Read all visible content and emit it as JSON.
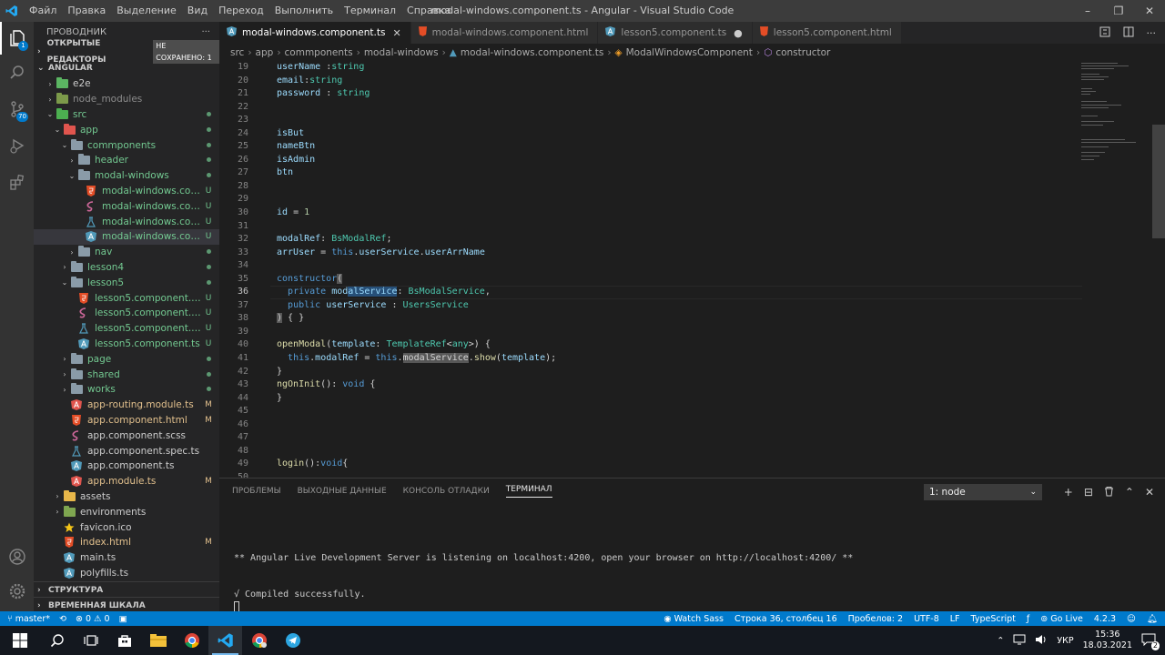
{
  "window": {
    "title": "modal-windows.component.ts - Angular - Visual Studio Code",
    "menu": [
      "Файл",
      "Правка",
      "Выделение",
      "Вид",
      "Переход",
      "Выполнить",
      "Терминал",
      "Справка"
    ],
    "controls": [
      "–",
      "❐",
      "✕"
    ]
  },
  "activity": {
    "source_control_badge": "70",
    "explorer_badge": "1"
  },
  "sidebar": {
    "title": "ПРОВОДНИК",
    "more": "···",
    "open_editors": "ОТКРЫТЫЕ РЕДАКТОРЫ",
    "unsaved": "НЕ СОХРАНЕНО: 1",
    "workspace": "ANGULAR",
    "tree": [
      {
        "label": "e2e",
        "depth": 1,
        "type": "folder",
        "color": "#5bb562",
        "chev": "›",
        "status": "",
        "tone": "norm"
      },
      {
        "label": "node_modules",
        "depth": 1,
        "type": "folder",
        "color": "#7c9a4a",
        "chev": "›",
        "status": "",
        "tone": "grey"
      },
      {
        "label": "src",
        "depth": 1,
        "type": "folder",
        "color": "#4caf50",
        "chev": "⌄",
        "status": "dot",
        "tone": "u"
      },
      {
        "label": "app",
        "depth": 2,
        "type": "folder",
        "color": "#e0554e",
        "chev": "⌄",
        "status": "dot",
        "tone": "u"
      },
      {
        "label": "commponents",
        "depth": 3,
        "type": "folder",
        "color": "#8a9ba8",
        "chev": "⌄",
        "status": "dot",
        "tone": "u"
      },
      {
        "label": "header",
        "depth": 4,
        "type": "folder",
        "color": "#8a9ba8",
        "chev": "›",
        "status": "dot",
        "tone": "u"
      },
      {
        "label": "modal-windows",
        "depth": 4,
        "type": "folder",
        "color": "#8a9ba8",
        "chev": "⌄",
        "status": "dot",
        "tone": "u"
      },
      {
        "label": "modal-windows.compo...",
        "depth": 5,
        "type": "html",
        "color": "#e44d26",
        "chev": "",
        "status": "U",
        "tone": "u"
      },
      {
        "label": "modal-windows.compo...",
        "depth": 5,
        "type": "scss",
        "color": "#cd6799",
        "chev": "",
        "status": "U",
        "tone": "u"
      },
      {
        "label": "modal-windows.compo...",
        "depth": 5,
        "type": "spec",
        "color": "#519aba",
        "chev": "",
        "status": "U",
        "tone": "u"
      },
      {
        "label": "modal-windows.compo...",
        "depth": 5,
        "type": "ts",
        "color": "#519aba",
        "chev": "",
        "status": "U",
        "tone": "u",
        "selected": true
      },
      {
        "label": "nav",
        "depth": 4,
        "type": "folder",
        "color": "#8a9ba8",
        "chev": "›",
        "status": "dot",
        "tone": "u"
      },
      {
        "label": "lesson4",
        "depth": 3,
        "type": "folder",
        "color": "#8a9ba8",
        "chev": "›",
        "status": "dot",
        "tone": "u"
      },
      {
        "label": "lesson5",
        "depth": 3,
        "type": "folder",
        "color": "#8a9ba8",
        "chev": "⌄",
        "status": "dot",
        "tone": "u"
      },
      {
        "label": "lesson5.component.html",
        "depth": 4,
        "type": "html",
        "color": "#e44d26",
        "chev": "",
        "status": "U",
        "tone": "u"
      },
      {
        "label": "lesson5.component.scss",
        "depth": 4,
        "type": "scss",
        "color": "#cd6799",
        "chev": "",
        "status": "U",
        "tone": "u"
      },
      {
        "label": "lesson5.component.spec.ts",
        "depth": 4,
        "type": "spec",
        "color": "#519aba",
        "chev": "",
        "status": "U",
        "tone": "u"
      },
      {
        "label": "lesson5.component.ts",
        "depth": 4,
        "type": "ts",
        "color": "#519aba",
        "chev": "",
        "status": "U",
        "tone": "u"
      },
      {
        "label": "page",
        "depth": 3,
        "type": "folder",
        "color": "#8a9ba8",
        "chev": "›",
        "status": "dot",
        "tone": "u"
      },
      {
        "label": "shared",
        "depth": 3,
        "type": "folder",
        "color": "#8a9ba8",
        "chev": "›",
        "status": "dot",
        "tone": "u"
      },
      {
        "label": "works",
        "depth": 3,
        "type": "folder",
        "color": "#8a9ba8",
        "chev": "›",
        "status": "dot",
        "tone": "u"
      },
      {
        "label": "app-routing.module.ts",
        "depth": 3,
        "type": "ng",
        "color": "#e0554e",
        "chev": "",
        "status": "M",
        "tone": "m"
      },
      {
        "label": "app.component.html",
        "depth": 3,
        "type": "html",
        "color": "#e44d26",
        "chev": "",
        "status": "M",
        "tone": "m"
      },
      {
        "label": "app.component.scss",
        "depth": 3,
        "type": "scss",
        "color": "#cd6799",
        "chev": "",
        "status": "",
        "tone": "norm"
      },
      {
        "label": "app.component.spec.ts",
        "depth": 3,
        "type": "spec",
        "color": "#519aba",
        "chev": "",
        "status": "",
        "tone": "norm"
      },
      {
        "label": "app.component.ts",
        "depth": 3,
        "type": "ts",
        "color": "#519aba",
        "chev": "",
        "status": "",
        "tone": "norm"
      },
      {
        "label": "app.module.ts",
        "depth": 3,
        "type": "ng",
        "color": "#e0554e",
        "chev": "",
        "status": "M",
        "tone": "m"
      },
      {
        "label": "assets",
        "depth": 2,
        "type": "folder",
        "color": "#e8b74a",
        "chev": "›",
        "status": "",
        "tone": "norm"
      },
      {
        "label": "environments",
        "depth": 2,
        "type": "folder",
        "color": "#7fa650",
        "chev": "›",
        "status": "",
        "tone": "norm"
      },
      {
        "label": "favicon.ico",
        "depth": 2,
        "type": "star",
        "color": "#f5c518",
        "chev": "",
        "status": "",
        "tone": "norm"
      },
      {
        "label": "index.html",
        "depth": 2,
        "type": "html",
        "color": "#e44d26",
        "chev": "",
        "status": "M",
        "tone": "m"
      },
      {
        "label": "main.ts",
        "depth": 2,
        "type": "ts",
        "color": "#519aba",
        "chev": "",
        "status": "",
        "tone": "norm"
      },
      {
        "label": "polyfills.ts",
        "depth": 2,
        "type": "ts",
        "color": "#519aba",
        "chev": "",
        "status": "",
        "tone": "norm"
      }
    ],
    "outline": "СТРУКТУРА",
    "timeline": "ВРЕМЕННАЯ ШКАЛА"
  },
  "tabs": [
    {
      "label": "modal-windows.component.ts",
      "icon": "ng",
      "color": "#519aba",
      "active": true,
      "suffix": "✕"
    },
    {
      "label": "modal-windows.component.html",
      "icon": "html",
      "color": "#e44d26",
      "active": false,
      "suffix": ""
    },
    {
      "label": "lesson5.component.ts",
      "icon": "ng",
      "color": "#519aba",
      "active": false,
      "suffix": "●"
    },
    {
      "label": "lesson5.component.html",
      "icon": "html",
      "color": "#e44d26",
      "active": false,
      "suffix": ""
    }
  ],
  "breadcrumbs": [
    "src",
    "app",
    "commponents",
    "modal-windows",
    "modal-windows.component.ts",
    "ModalWindowsComponent",
    "constructor"
  ],
  "editor": {
    "first_line": 19,
    "current_line": 36,
    "lines": [
      [
        [
          "v",
          "userName "
        ],
        [
          "p",
          ":"
        ],
        [
          "t",
          "string"
        ]
      ],
      [
        [
          "v",
          "email"
        ],
        [
          "p",
          ":"
        ],
        [
          "t",
          "string"
        ]
      ],
      [
        [
          "v",
          "password "
        ],
        [
          "p",
          ": "
        ],
        [
          "t",
          "string"
        ]
      ],
      [],
      [],
      [
        [
          "v",
          "isBut"
        ]
      ],
      [
        [
          "v",
          "nameBtn"
        ]
      ],
      [
        [
          "v",
          "isAdmin"
        ]
      ],
      [
        [
          "v",
          "btn"
        ]
      ],
      [],
      [],
      [
        [
          "v",
          "id "
        ],
        [
          "p",
          "= "
        ],
        [
          "n",
          "1"
        ]
      ],
      [],
      [
        [
          "v",
          "modalRef"
        ],
        [
          "p",
          ": "
        ],
        [
          "t",
          "BsModalRef"
        ],
        [
          "p",
          ";"
        ]
      ],
      [
        [
          "v",
          "arrUser "
        ],
        [
          "p",
          "= "
        ],
        [
          "k",
          "this"
        ],
        [
          "p",
          "."
        ],
        [
          "v",
          "userService"
        ],
        [
          "p",
          "."
        ],
        [
          "v",
          "userArrName"
        ]
      ],
      [],
      [
        [
          "k",
          "constructor"
        ],
        [
          "hlw",
          "("
        ]
      ],
      [
        [
          "p",
          "  "
        ],
        [
          "k",
          "private "
        ],
        [
          "v",
          "mod"
        ],
        [
          "hl",
          "alService"
        ],
        [
          "p",
          ": "
        ],
        [
          "t",
          "BsModalService"
        ],
        [
          "p",
          ","
        ]
      ],
      [
        [
          "p",
          "  "
        ],
        [
          "k",
          "public "
        ],
        [
          "v",
          "userService "
        ],
        [
          "p",
          ": "
        ],
        [
          "t",
          "UsersService"
        ]
      ],
      [
        [
          "hlw",
          ")"
        ],
        [
          "p",
          " { }"
        ]
      ],
      [],
      [
        [
          "f",
          "openModal"
        ],
        [
          "p",
          "("
        ],
        [
          "v",
          "template"
        ],
        [
          "p",
          ": "
        ],
        [
          "t",
          "TemplateRef"
        ],
        [
          "p",
          "<"
        ],
        [
          "t",
          "any"
        ],
        [
          "p",
          ">) {"
        ]
      ],
      [
        [
          "p",
          "  "
        ],
        [
          "k",
          "this"
        ],
        [
          "p",
          "."
        ],
        [
          "v",
          "modalRef "
        ],
        [
          "p",
          "= "
        ],
        [
          "k",
          "this"
        ],
        [
          "p",
          "."
        ],
        [
          "hlw",
          "modalService"
        ],
        [
          "p",
          "."
        ],
        [
          "f",
          "show"
        ],
        [
          "p",
          "("
        ],
        [
          "v",
          "template"
        ],
        [
          "p",
          ");"
        ]
      ],
      [
        [
          "p",
          "}"
        ]
      ],
      [
        [
          "f",
          "ngOnInit"
        ],
        [
          "p",
          "(): "
        ],
        [
          "k",
          "void "
        ],
        [
          "p",
          "{"
        ]
      ],
      [
        [
          "p",
          "}"
        ]
      ],
      [],
      [],
      [],
      [],
      [
        [
          "f",
          "login"
        ],
        [
          "p",
          "():"
        ],
        [
          "k",
          "void"
        ],
        [
          "p",
          "{"
        ]
      ],
      []
    ]
  },
  "panel": {
    "tabs": [
      "ПРОБЛЕМЫ",
      "ВЫХОДНЫЕ ДАННЫЕ",
      "КОНСОЛЬ ОТЛАДКИ",
      "ТЕРМИНАЛ"
    ],
    "active_tab": 3,
    "terminal_select": "1: node",
    "actions": [
      "+",
      "⊟",
      "🗑",
      "⌃",
      "✕"
    ],
    "terminal_lines": [
      "",
      "",
      "",
      "** Angular Live Development Server is listening on localhost:4200, open your browser on http://localhost:4200/ **",
      "",
      "",
      "√ Compiled successfully."
    ]
  },
  "status": {
    "branch": "master*",
    "sync": "⟲",
    "problems": "⊗ 0 ⚠ 0",
    "watch_sass": "Watch Sass",
    "position": "Строка 36, столбец 16",
    "spaces": "Пробелов: 2",
    "encoding": "UTF-8",
    "eol": "LF",
    "language": "TypeScript",
    "golive": "Go Live",
    "version": "4.2.3"
  },
  "taskbar": {
    "lang": "УКР",
    "time": "15:36",
    "date": "18.03.2021",
    "notif": "2"
  },
  "colors": {
    "accent": "#007acc",
    "editor_bg": "#1e1e1e",
    "sidebar_bg": "#252526"
  }
}
